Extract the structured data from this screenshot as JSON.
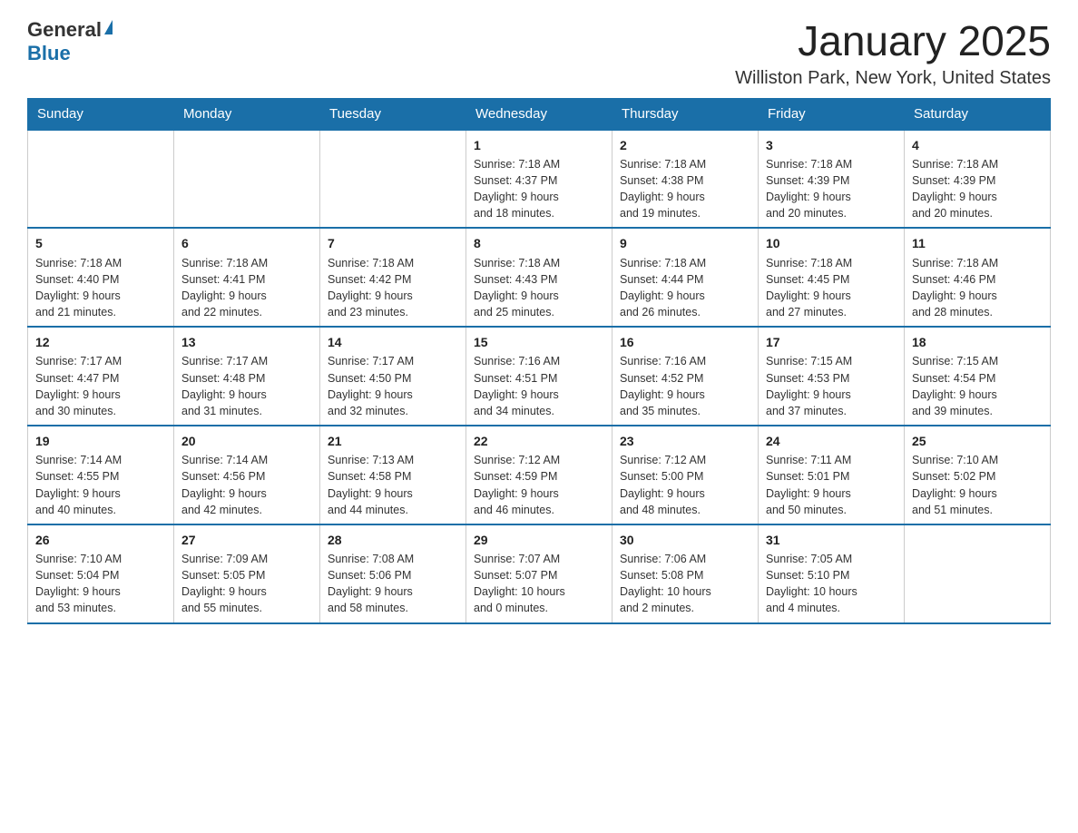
{
  "header": {
    "logo_general": "General",
    "logo_blue": "Blue",
    "title": "January 2025",
    "subtitle": "Williston Park, New York, United States"
  },
  "days_of_week": [
    "Sunday",
    "Monday",
    "Tuesday",
    "Wednesday",
    "Thursday",
    "Friday",
    "Saturday"
  ],
  "weeks": [
    {
      "days": [
        {
          "number": "",
          "info": ""
        },
        {
          "number": "",
          "info": ""
        },
        {
          "number": "",
          "info": ""
        },
        {
          "number": "1",
          "info": "Sunrise: 7:18 AM\nSunset: 4:37 PM\nDaylight: 9 hours\nand 18 minutes."
        },
        {
          "number": "2",
          "info": "Sunrise: 7:18 AM\nSunset: 4:38 PM\nDaylight: 9 hours\nand 19 minutes."
        },
        {
          "number": "3",
          "info": "Sunrise: 7:18 AM\nSunset: 4:39 PM\nDaylight: 9 hours\nand 20 minutes."
        },
        {
          "number": "4",
          "info": "Sunrise: 7:18 AM\nSunset: 4:39 PM\nDaylight: 9 hours\nand 20 minutes."
        }
      ]
    },
    {
      "days": [
        {
          "number": "5",
          "info": "Sunrise: 7:18 AM\nSunset: 4:40 PM\nDaylight: 9 hours\nand 21 minutes."
        },
        {
          "number": "6",
          "info": "Sunrise: 7:18 AM\nSunset: 4:41 PM\nDaylight: 9 hours\nand 22 minutes."
        },
        {
          "number": "7",
          "info": "Sunrise: 7:18 AM\nSunset: 4:42 PM\nDaylight: 9 hours\nand 23 minutes."
        },
        {
          "number": "8",
          "info": "Sunrise: 7:18 AM\nSunset: 4:43 PM\nDaylight: 9 hours\nand 25 minutes."
        },
        {
          "number": "9",
          "info": "Sunrise: 7:18 AM\nSunset: 4:44 PM\nDaylight: 9 hours\nand 26 minutes."
        },
        {
          "number": "10",
          "info": "Sunrise: 7:18 AM\nSunset: 4:45 PM\nDaylight: 9 hours\nand 27 minutes."
        },
        {
          "number": "11",
          "info": "Sunrise: 7:18 AM\nSunset: 4:46 PM\nDaylight: 9 hours\nand 28 minutes."
        }
      ]
    },
    {
      "days": [
        {
          "number": "12",
          "info": "Sunrise: 7:17 AM\nSunset: 4:47 PM\nDaylight: 9 hours\nand 30 minutes."
        },
        {
          "number": "13",
          "info": "Sunrise: 7:17 AM\nSunset: 4:48 PM\nDaylight: 9 hours\nand 31 minutes."
        },
        {
          "number": "14",
          "info": "Sunrise: 7:17 AM\nSunset: 4:50 PM\nDaylight: 9 hours\nand 32 minutes."
        },
        {
          "number": "15",
          "info": "Sunrise: 7:16 AM\nSunset: 4:51 PM\nDaylight: 9 hours\nand 34 minutes."
        },
        {
          "number": "16",
          "info": "Sunrise: 7:16 AM\nSunset: 4:52 PM\nDaylight: 9 hours\nand 35 minutes."
        },
        {
          "number": "17",
          "info": "Sunrise: 7:15 AM\nSunset: 4:53 PM\nDaylight: 9 hours\nand 37 minutes."
        },
        {
          "number": "18",
          "info": "Sunrise: 7:15 AM\nSunset: 4:54 PM\nDaylight: 9 hours\nand 39 minutes."
        }
      ]
    },
    {
      "days": [
        {
          "number": "19",
          "info": "Sunrise: 7:14 AM\nSunset: 4:55 PM\nDaylight: 9 hours\nand 40 minutes."
        },
        {
          "number": "20",
          "info": "Sunrise: 7:14 AM\nSunset: 4:56 PM\nDaylight: 9 hours\nand 42 minutes."
        },
        {
          "number": "21",
          "info": "Sunrise: 7:13 AM\nSunset: 4:58 PM\nDaylight: 9 hours\nand 44 minutes."
        },
        {
          "number": "22",
          "info": "Sunrise: 7:12 AM\nSunset: 4:59 PM\nDaylight: 9 hours\nand 46 minutes."
        },
        {
          "number": "23",
          "info": "Sunrise: 7:12 AM\nSunset: 5:00 PM\nDaylight: 9 hours\nand 48 minutes."
        },
        {
          "number": "24",
          "info": "Sunrise: 7:11 AM\nSunset: 5:01 PM\nDaylight: 9 hours\nand 50 minutes."
        },
        {
          "number": "25",
          "info": "Sunrise: 7:10 AM\nSunset: 5:02 PM\nDaylight: 9 hours\nand 51 minutes."
        }
      ]
    },
    {
      "days": [
        {
          "number": "26",
          "info": "Sunrise: 7:10 AM\nSunset: 5:04 PM\nDaylight: 9 hours\nand 53 minutes."
        },
        {
          "number": "27",
          "info": "Sunrise: 7:09 AM\nSunset: 5:05 PM\nDaylight: 9 hours\nand 55 minutes."
        },
        {
          "number": "28",
          "info": "Sunrise: 7:08 AM\nSunset: 5:06 PM\nDaylight: 9 hours\nand 58 minutes."
        },
        {
          "number": "29",
          "info": "Sunrise: 7:07 AM\nSunset: 5:07 PM\nDaylight: 10 hours\nand 0 minutes."
        },
        {
          "number": "30",
          "info": "Sunrise: 7:06 AM\nSunset: 5:08 PM\nDaylight: 10 hours\nand 2 minutes."
        },
        {
          "number": "31",
          "info": "Sunrise: 7:05 AM\nSunset: 5:10 PM\nDaylight: 10 hours\nand 4 minutes."
        },
        {
          "number": "",
          "info": ""
        }
      ]
    }
  ]
}
